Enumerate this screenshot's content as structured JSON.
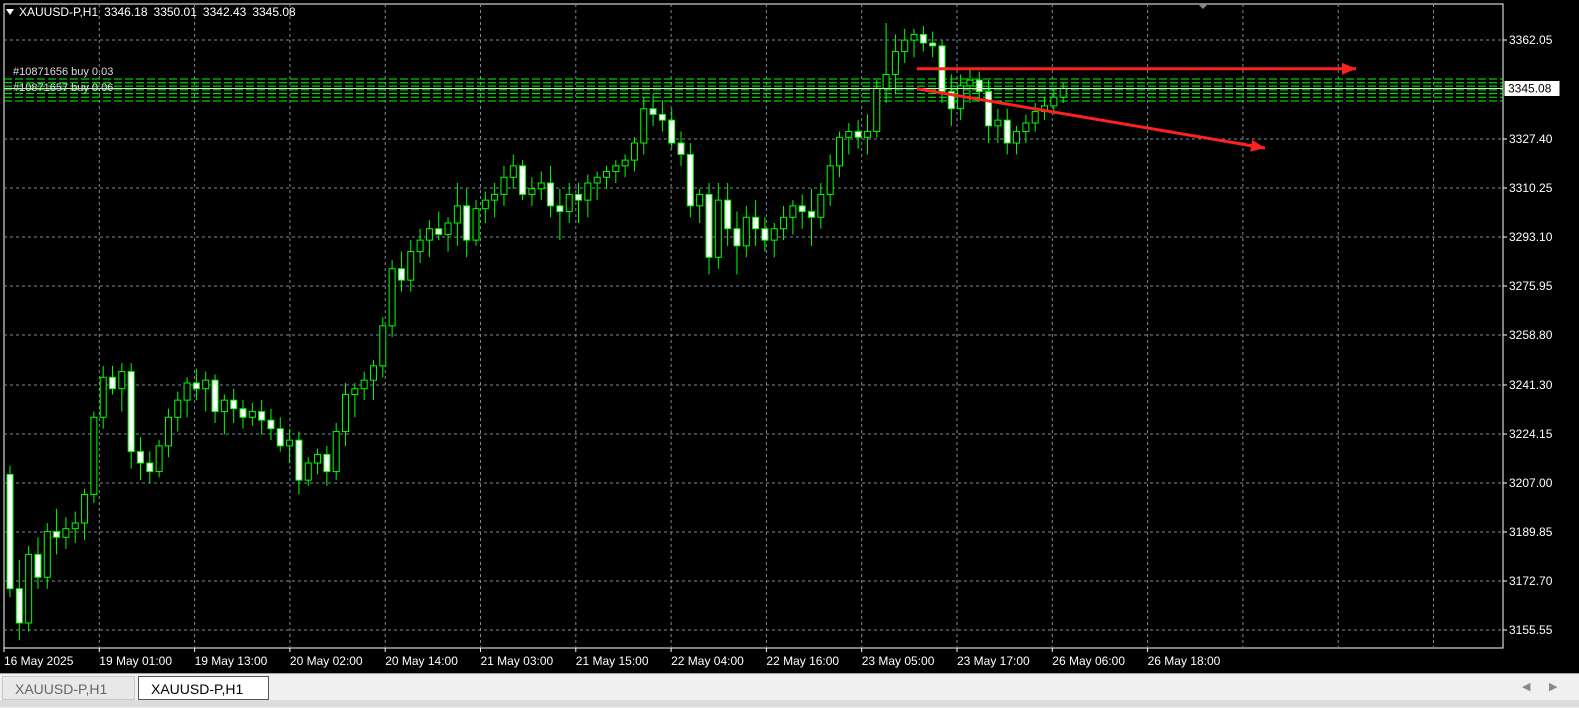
{
  "window": {
    "symbol_title": "XAUUSD-P,H1",
    "ohlc": [
      "3346.18",
      "3350.01",
      "3342.43",
      "3345.08"
    ]
  },
  "tabs": [
    {
      "label": "XAUUSD-P,H1",
      "active": false
    },
    {
      "label": "XAUUSD-P,H1",
      "active": true
    }
  ],
  "colors": {
    "background": "#000000",
    "grid": "#7a8a9a",
    "candle": "#00ff00",
    "order_lines": "#00ff00",
    "arrow": "#ff2020",
    "text": "#ffffff"
  },
  "order_labels": [
    "#10871656 buy 0.03",
    "#10871657 buy 0.06"
  ],
  "chart_data": {
    "type": "candlestick",
    "symbol": "XAUUSD-P",
    "timeframe": "H1",
    "grid": true,
    "ylim": [
      3146,
      3380
    ],
    "y_ticks": [
      3155.55,
      3172.7,
      3189.85,
      3207.0,
      3224.15,
      3241.3,
      3258.8,
      3275.95,
      3293.1,
      3310.25,
      3327.4,
      3345.08,
      3362.05
    ],
    "y_tick_labels": [
      "3155.55",
      "3172.70",
      "3189.85",
      "3207.00",
      "3224.15",
      "3241.30",
      "3258.80",
      "3275.95",
      "3293.10",
      "3310.25",
      "3327.40",
      "3345.08",
      "3362.05"
    ],
    "current_price": 3345.08,
    "current_price_label": "3345.08",
    "x_tick_labels": [
      "16 May 2025",
      "19 May 01:00",
      "19 May 13:00",
      "20 May 02:00",
      "20 May 14:00",
      "21 May 03:00",
      "21 May 15:00",
      "22 May 04:00",
      "22 May 16:00",
      "23 May 05:00",
      "23 May 17:00",
      "26 May 06:00",
      "26 May 18:00"
    ],
    "candles": [
      [
        3210,
        3213,
        3167,
        3170
      ],
      [
        3170,
        3180,
        3152,
        3158
      ],
      [
        3158,
        3185,
        3155,
        3182
      ],
      [
        3182,
        3188,
        3170,
        3174
      ],
      [
        3174,
        3193,
        3170,
        3190
      ],
      [
        3190,
        3198,
        3182,
        3188
      ],
      [
        3188,
        3195,
        3184,
        3191
      ],
      [
        3191,
        3197,
        3186,
        3193
      ],
      [
        3193,
        3205,
        3187,
        3203
      ],
      [
        3203,
        3232,
        3200,
        3230
      ],
      [
        3230,
        3248,
        3226,
        3244
      ],
      [
        3244,
        3248,
        3238,
        3240
      ],
      [
        3240,
        3249,
        3232,
        3246
      ],
      [
        3246,
        3249,
        3212,
        3218
      ],
      [
        3218,
        3223,
        3208,
        3214
      ],
      [
        3214,
        3218,
        3207,
        3211
      ],
      [
        3211,
        3222,
        3209,
        3220
      ],
      [
        3220,
        3233,
        3216,
        3230
      ],
      [
        3230,
        3239,
        3225,
        3236
      ],
      [
        3236,
        3244,
        3230,
        3242
      ],
      [
        3242,
        3247,
        3236,
        3240
      ],
      [
        3240,
        3246,
        3232,
        3243
      ],
      [
        3243,
        3245,
        3228,
        3232
      ],
      [
        3232,
        3238,
        3224,
        3236
      ],
      [
        3236,
        3240,
        3228,
        3233
      ],
      [
        3233,
        3236,
        3226,
        3230
      ],
      [
        3230,
        3235,
        3227,
        3232
      ],
      [
        3232,
        3236,
        3224,
        3229
      ],
      [
        3229,
        3233,
        3222,
        3226
      ],
      [
        3226,
        3230,
        3218,
        3220
      ],
      [
        3220,
        3226,
        3214,
        3222
      ],
      [
        3222,
        3225,
        3203,
        3208
      ],
      [
        3208,
        3216,
        3206,
        3214
      ],
      [
        3214,
        3219,
        3210,
        3217
      ],
      [
        3217,
        3220,
        3206,
        3211
      ],
      [
        3211,
        3228,
        3208,
        3225
      ],
      [
        3225,
        3242,
        3220,
        3238
      ],
      [
        3238,
        3242,
        3230,
        3240
      ],
      [
        3240,
        3246,
        3236,
        3243
      ],
      [
        3243,
        3250,
        3236,
        3248
      ],
      [
        3248,
        3265,
        3244,
        3262
      ],
      [
        3262,
        3285,
        3258,
        3282
      ],
      [
        3282,
        3288,
        3274,
        3278
      ],
      [
        3278,
        3292,
        3274,
        3288
      ],
      [
        3288,
        3296,
        3284,
        3292
      ],
      [
        3292,
        3299,
        3286,
        3296
      ],
      [
        3296,
        3302,
        3292,
        3294
      ],
      [
        3294,
        3300,
        3288,
        3298
      ],
      [
        3298,
        3312,
        3290,
        3304
      ],
      [
        3304,
        3310,
        3286,
        3292
      ],
      [
        3292,
        3306,
        3290,
        3303
      ],
      [
        3303,
        3309,
        3298,
        3306
      ],
      [
        3306,
        3312,
        3300,
        3308
      ],
      [
        3308,
        3318,
        3304,
        3314
      ],
      [
        3314,
        3322,
        3310,
        3318
      ],
      [
        3318,
        3320,
        3306,
        3308
      ],
      [
        3308,
        3314,
        3304,
        3310
      ],
      [
        3310,
        3316,
        3306,
        3312
      ],
      [
        3312,
        3318,
        3300,
        3304
      ],
      [
        3304,
        3310,
        3292,
        3302
      ],
      [
        3302,
        3312,
        3298,
        3308
      ],
      [
        3308,
        3312,
        3298,
        3306
      ],
      [
        3306,
        3315,
        3300,
        3312
      ],
      [
        3312,
        3316,
        3306,
        3314
      ],
      [
        3314,
        3318,
        3310,
        3316
      ],
      [
        3316,
        3320,
        3312,
        3318
      ],
      [
        3318,
        3322,
        3314,
        3320
      ],
      [
        3320,
        3328,
        3316,
        3326
      ],
      [
        3326,
        3342,
        3322,
        3338
      ],
      [
        3338,
        3343,
        3332,
        3336
      ],
      [
        3336,
        3341,
        3330,
        3334
      ],
      [
        3334,
        3338,
        3324,
        3326
      ],
      [
        3326,
        3330,
        3318,
        3322
      ],
      [
        3322,
        3326,
        3300,
        3304
      ],
      [
        3304,
        3310,
        3298,
        3308
      ],
      [
        3308,
        3312,
        3280,
        3286
      ],
      [
        3286,
        3312,
        3282,
        3306
      ],
      [
        3306,
        3312,
        3290,
        3296
      ],
      [
        3296,
        3302,
        3280,
        3290
      ],
      [
        3290,
        3304,
        3286,
        3300
      ],
      [
        3300,
        3306,
        3290,
        3296
      ],
      [
        3296,
        3300,
        3288,
        3292
      ],
      [
        3292,
        3298,
        3286,
        3296
      ],
      [
        3296,
        3304,
        3292,
        3300
      ],
      [
        3300,
        3306,
        3294,
        3304
      ],
      [
        3304,
        3308,
        3296,
        3302
      ],
      [
        3302,
        3310,
        3290,
        3300
      ],
      [
        3300,
        3312,
        3296,
        3308
      ],
      [
        3308,
        3322,
        3304,
        3318
      ],
      [
        3318,
        3330,
        3314,
        3328
      ],
      [
        3328,
        3333,
        3322,
        3330
      ],
      [
        3330,
        3334,
        3324,
        3328
      ],
      [
        3328,
        3336,
        3322,
        3330
      ],
      [
        3330,
        3348,
        3328,
        3345
      ],
      [
        3345,
        3368,
        3340,
        3350
      ],
      [
        3350,
        3364,
        3343,
        3358
      ],
      [
        3358,
        3366,
        3354,
        3362
      ],
      [
        3362,
        3366,
        3356,
        3364
      ],
      [
        3364,
        3367,
        3358,
        3361
      ],
      [
        3361,
        3365,
        3356,
        3360
      ],
      [
        3360,
        3362,
        3340,
        3344
      ],
      [
        3344,
        3350,
        3332,
        3338
      ],
      [
        3338,
        3350,
        3334,
        3346
      ],
      [
        3346,
        3352,
        3340,
        3348
      ],
      [
        3348,
        3351,
        3341,
        3344
      ],
      [
        3344,
        3348,
        3326,
        3332
      ],
      [
        3332,
        3338,
        3326,
        3334
      ],
      [
        3334,
        3338,
        3322,
        3326
      ],
      [
        3326,
        3332,
        3322,
        3330
      ],
      [
        3330,
        3336,
        3326,
        3333
      ],
      [
        3333,
        3340,
        3330,
        3337
      ],
      [
        3337,
        3342,
        3334,
        3339
      ],
      [
        3339,
        3345,
        3336,
        3342
      ],
      [
        3342,
        3347,
        3340,
        3345
      ]
    ],
    "order_levels": [
      3348.4,
      3347.1,
      3345.9,
      3344.6,
      3343.3,
      3342.0,
      3340.7
    ],
    "annotations": [
      {
        "type": "arrow",
        "from": [
          3362,
          3352
        ],
        "to": [
          3382,
          3352
        ],
        "color": "#ff2020"
      },
      {
        "type": "arrow",
        "from": [
          3362,
          3345
        ],
        "to": [
          3382,
          3332
        ],
        "color": "#ff2020"
      }
    ]
  }
}
